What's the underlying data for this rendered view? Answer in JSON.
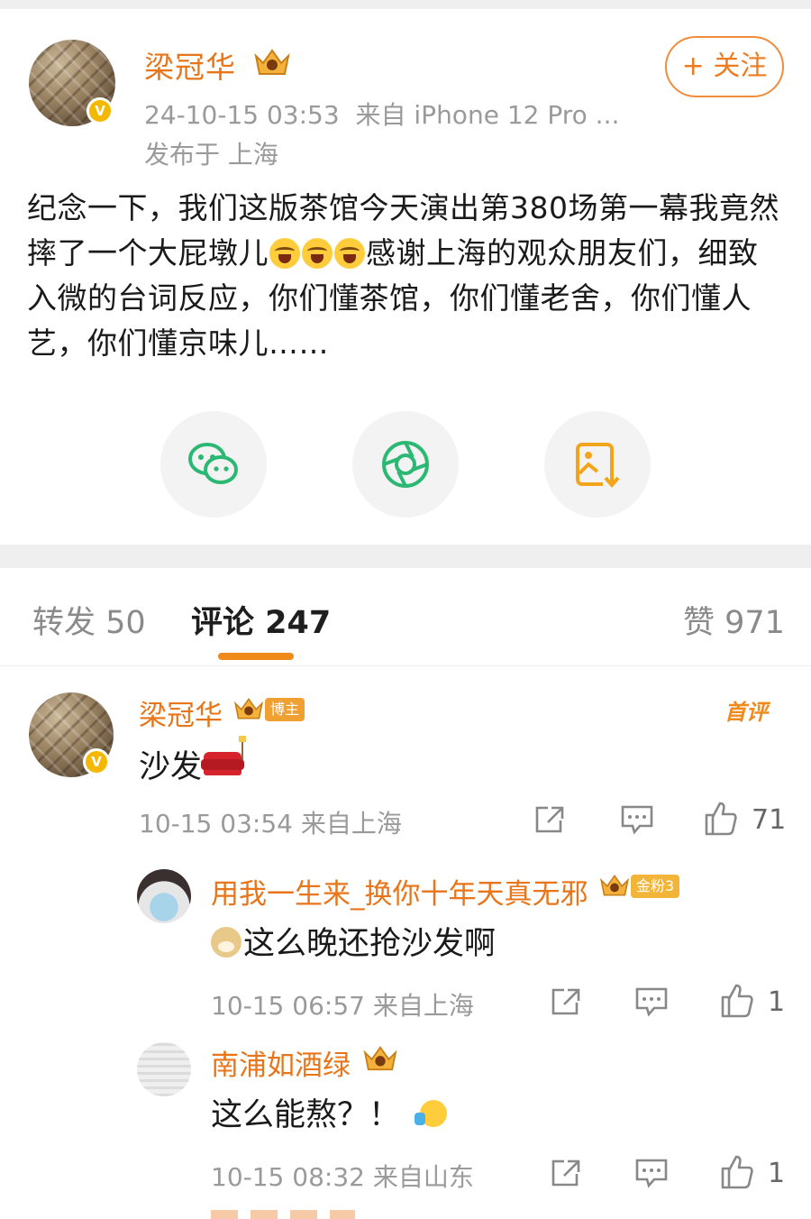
{
  "post": {
    "author": "梁冠华",
    "date": "24-10-15 03:53",
    "source": "来自 iPhone 12 Pro ...",
    "location": "发布于 上海",
    "follow_label": "+ 关注",
    "text_before_emoji": "纪念一下，我们这版茶馆今天演出第380场第一幕我竟然摔了一个大屁墩儿",
    "text_after_emoji": "感谢上海的观众朋友们，细致入微的台词反应，你们懂茶馆，你们懂老舍，你们懂人艺，你们懂京味儿……",
    "emoji_count": 3,
    "share_targets": [
      "wechat-icon",
      "moments-icon",
      "save-image-icon"
    ]
  },
  "tabs": {
    "repost": "转发 50",
    "comment": "评论 247",
    "like": "赞 971"
  },
  "comments": [
    {
      "name": "梁冠华",
      "tag": "博主",
      "badge": "首评",
      "text": "沙发",
      "time": "10-15 03:54",
      "source": "来自上海",
      "likes": "71"
    },
    {
      "name": "用我一生来_换你十年天真无邪",
      "tag": "金粉3",
      "text": "这么晚还抢沙发啊",
      "time": "10-15 06:57",
      "source": "来自上海",
      "likes": "1"
    },
    {
      "name": "南浦如酒绿",
      "text": "这么能熬？！",
      "time": "10-15 08:32",
      "source": "来自山东",
      "likes": "1"
    }
  ],
  "colors": {
    "accent": "#f08a1c",
    "name": "#e8751a",
    "meta": "#9a9a9a",
    "vip": "#f5b800",
    "wechat": "#2bb873"
  }
}
